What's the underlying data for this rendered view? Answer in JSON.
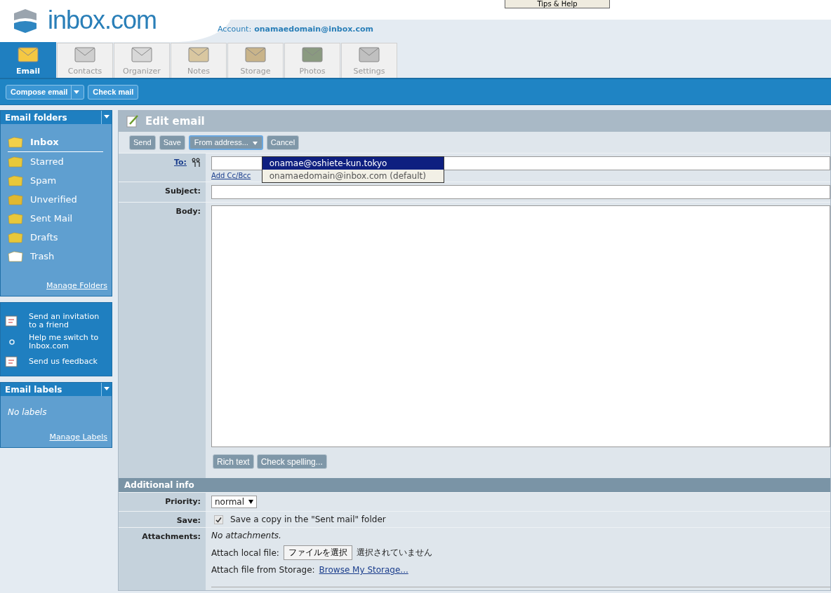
{
  "header": {
    "logo": "inbox.com",
    "account_label": "Account:",
    "account_email": "onamaedomain@inbox.com",
    "help_button": "Tips & Help"
  },
  "tabs": [
    {
      "label": "Email",
      "selected": true
    },
    {
      "label": "Contacts",
      "selected": false
    },
    {
      "label": "Organizer",
      "selected": false
    },
    {
      "label": "Notes",
      "selected": false
    },
    {
      "label": "Storage",
      "selected": false
    },
    {
      "label": "Photos",
      "selected": false
    },
    {
      "label": "Settings",
      "selected": false
    }
  ],
  "toolbar": {
    "compose": "Compose email",
    "check": "Check mail"
  },
  "folders_panel": {
    "title": "Email folders",
    "items": [
      {
        "label": "Inbox",
        "selected": true
      },
      {
        "label": "Starred",
        "selected": false
      },
      {
        "label": "Spam",
        "selected": false
      },
      {
        "label": "Unverified",
        "selected": false
      },
      {
        "label": "Sent Mail",
        "selected": false
      },
      {
        "label": "Drafts",
        "selected": false
      },
      {
        "label": "Trash",
        "selected": false
      }
    ],
    "manage": "Manage Folders"
  },
  "links_panel": {
    "items": [
      {
        "label": "Send an invitation to a friend"
      },
      {
        "label": "Help me switch to Inbox.com"
      },
      {
        "label": "Send us feedback"
      }
    ]
  },
  "labels_panel": {
    "title": "Email labels",
    "empty": "No labels",
    "manage": "Manage Labels"
  },
  "editor": {
    "title": "Edit email",
    "buttons": [
      {
        "label": "Send",
        "kind": "button"
      },
      {
        "label": "Save",
        "kind": "button"
      },
      {
        "label": "From address...",
        "kind": "dropdown",
        "expanded": true
      },
      {
        "label": "Cancel",
        "kind": "button"
      }
    ],
    "from_menu": [
      {
        "label": "onamae@oshiete-kun.tokyo",
        "selected": true
      },
      {
        "label": "onamaedomain@inbox.com (default)",
        "selected": false
      }
    ],
    "to_label": "To:",
    "add_cc": "Add Cc/Bcc",
    "subject_label": "Subject:",
    "body_label": "Body:",
    "body_buttons": [
      "Rich text",
      "Check spelling..."
    ]
  },
  "additional": {
    "title": "Additional info",
    "priority_label": "Priority:",
    "priority": "normal",
    "save_label": "Save:",
    "save_checked": true,
    "save_text": "Save a copy in the \"Sent mail\" folder",
    "attachments_label": "Attachments:",
    "no_attachments": "No attachments.",
    "local_label": "Attach local file:",
    "file_button": "ファイルを選択",
    "file_status": "選択されていません",
    "storage_label": "Attach file from Storage:",
    "storage_link": "Browse My Storage..."
  }
}
